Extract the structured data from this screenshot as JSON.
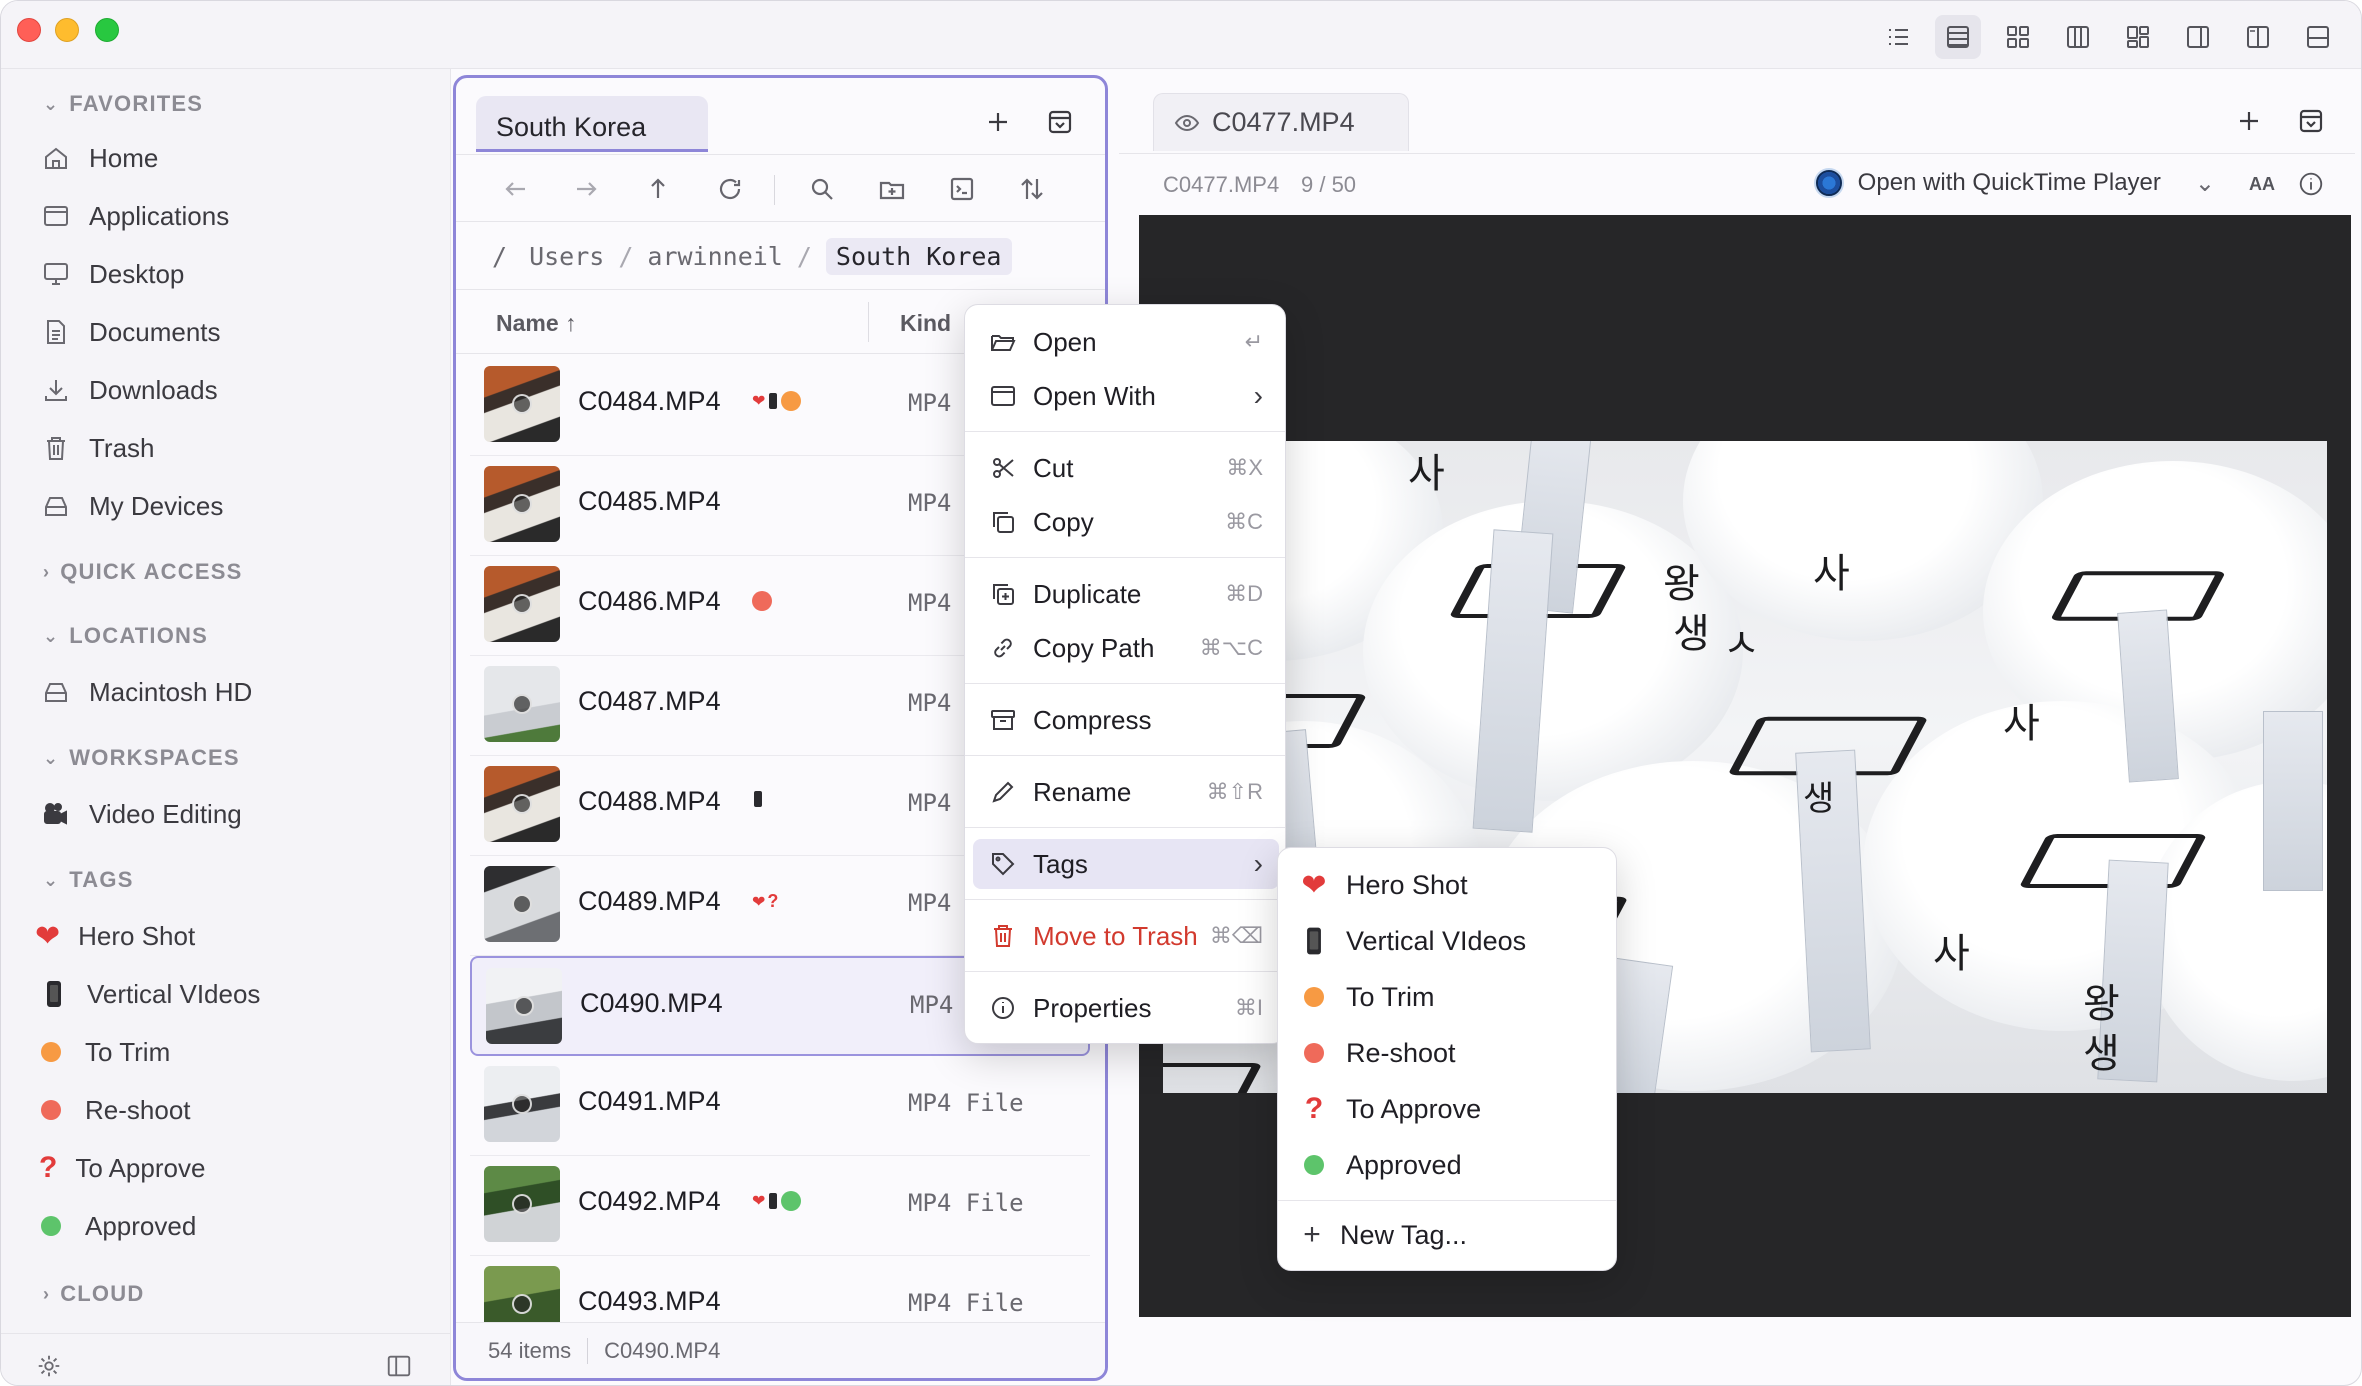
{
  "colors": {
    "accent": "#8e86d8",
    "orange": "#f79a43",
    "red": "#ef6a5a",
    "green": "#5dc46b",
    "danger": "#d23a2e"
  },
  "sidebar": {
    "favorites_label": "FAVORITES",
    "favorites": [
      {
        "label": "Home",
        "icon": "house-icon"
      },
      {
        "label": "Applications",
        "icon": "window-icon"
      },
      {
        "label": "Desktop",
        "icon": "monitor-icon"
      },
      {
        "label": "Documents",
        "icon": "document-icon"
      },
      {
        "label": "Downloads",
        "icon": "download-icon"
      },
      {
        "label": "Trash",
        "icon": "trash-icon"
      },
      {
        "label": "My Devices",
        "icon": "drive-icon"
      }
    ],
    "quick_access_label": "QUICK ACCESS",
    "locations_label": "LOCATIONS",
    "locations": [
      {
        "label": "Macintosh HD",
        "icon": "drive-icon"
      }
    ],
    "workspaces_label": "WORKSPACES",
    "workspaces": [
      {
        "label": "Video Editing",
        "icon": "video-camera-icon"
      }
    ],
    "tags_label": "TAGS",
    "tags": [
      {
        "label": "Hero Shot",
        "icon": "heart-icon"
      },
      {
        "label": "Vertical VIdeos",
        "icon": "phone-icon"
      },
      {
        "label": "To Trim",
        "color": "#f79a43"
      },
      {
        "label": "Re-shoot",
        "color": "#ef6a5a"
      },
      {
        "label": "To Approve",
        "icon": "question-icon"
      },
      {
        "label": "Approved",
        "color": "#5dc46b"
      }
    ],
    "cloud_label": "CLOUD"
  },
  "filepane": {
    "tab_label": "South Korea",
    "breadcrumb": {
      "root": "/",
      "parts": [
        "Users",
        "arwinneil"
      ],
      "current": "South Korea"
    },
    "columns": {
      "name": "Name",
      "kind": "Kind"
    },
    "files": [
      {
        "name": "C0484.MP4",
        "kind": "MP4",
        "tags": [
          "heart",
          "phone",
          "orange"
        ]
      },
      {
        "name": "C0485.MP4",
        "kind": "MP4",
        "tags": []
      },
      {
        "name": "C0486.MP4",
        "kind": "MP4",
        "tags": [
          "red"
        ]
      },
      {
        "name": "C0487.MP4",
        "kind": "MP4",
        "tags": []
      },
      {
        "name": "C0488.MP4",
        "kind": "MP4",
        "tags": [
          "phone"
        ]
      },
      {
        "name": "C0489.MP4",
        "kind": "MP4",
        "tags": [
          "heart",
          "question"
        ]
      },
      {
        "name": "C0490.MP4",
        "kind": "MP4",
        "tags": []
      },
      {
        "name": "C0491.MP4",
        "kind": "MP4 File",
        "tags": []
      },
      {
        "name": "C0492.MP4",
        "kind": "MP4 File",
        "tags": [
          "heart",
          "phone",
          "green"
        ]
      },
      {
        "name": "C0493.MP4",
        "kind": "MP4 File",
        "tags": []
      }
    ],
    "status": {
      "count": "54 items",
      "selected": "C0490.MP4"
    }
  },
  "preview": {
    "tab_label": "C0477.MP4",
    "file_name": "C0477.MP4",
    "position": "9 / 50",
    "open_with": "Open with QuickTime Player",
    "font_toggle": "AA"
  },
  "context_menu": {
    "items": [
      {
        "label": "Open",
        "shortcut": "↵",
        "icon": "folder-open-icon"
      },
      {
        "label": "Open With",
        "shortcut": "›",
        "icon": "window-icon"
      },
      {
        "label": "Cut",
        "shortcut": "⌘X",
        "icon": "scissors-icon"
      },
      {
        "label": "Copy",
        "shortcut": "⌘C",
        "icon": "copy-icon"
      },
      {
        "label": "Duplicate",
        "shortcut": "⌘D",
        "icon": "duplicate-icon"
      },
      {
        "label": "Copy Path",
        "shortcut": "⌘⌥C",
        "icon": "link-icon"
      },
      {
        "label": "Compress",
        "shortcut": "",
        "icon": "archive-icon"
      },
      {
        "label": "Rename",
        "shortcut": "⌘⇧R",
        "icon": "pencil-icon"
      },
      {
        "label": "Tags",
        "shortcut": "›",
        "icon": "tag-icon"
      },
      {
        "label": "Move to Trash",
        "shortcut": "⌘⌫",
        "icon": "trash-icon"
      },
      {
        "label": "Properties",
        "shortcut": "⌘I",
        "icon": "info-icon"
      }
    ]
  },
  "tags_submenu": {
    "items": [
      {
        "label": "Hero Shot",
        "icon": "heart-icon"
      },
      {
        "label": "Vertical VIdeos",
        "icon": "phone-icon"
      },
      {
        "label": "To Trim",
        "color": "#f79a43"
      },
      {
        "label": "Re-shoot",
        "color": "#ef6a5a"
      },
      {
        "label": "To Approve",
        "icon": "question-icon"
      },
      {
        "label": "Approved",
        "color": "#5dc46b"
      }
    ],
    "new_tag": "New Tag..."
  }
}
